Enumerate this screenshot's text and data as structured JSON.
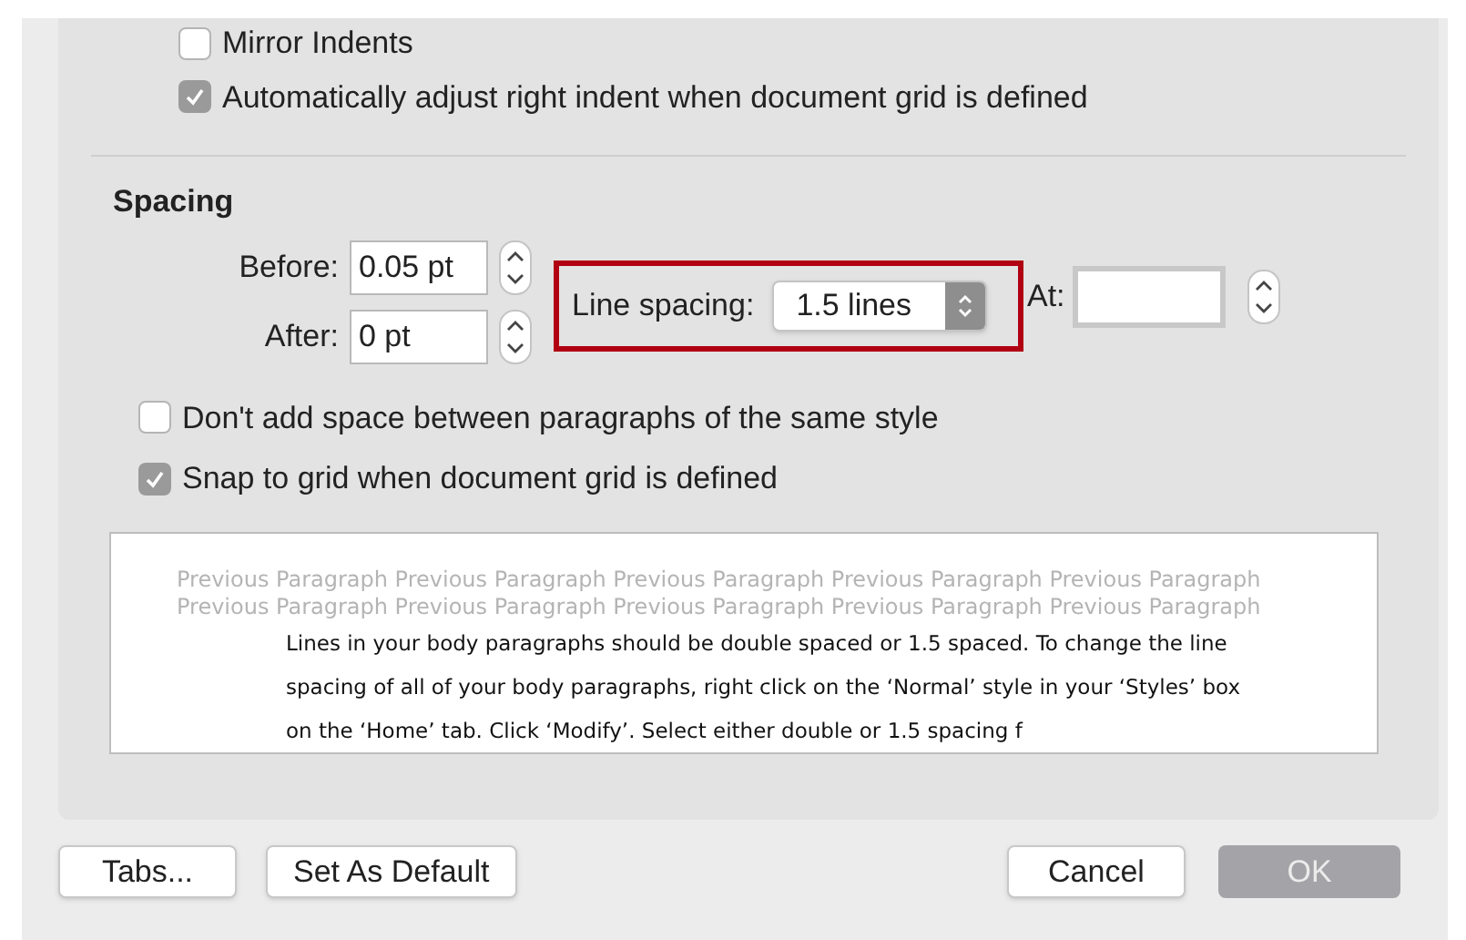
{
  "indents_options": [
    {
      "label": "Mirror Indents",
      "checked": false
    },
    {
      "label": "Automatically adjust right indent when document grid is defined",
      "checked": true
    }
  ],
  "spacing": {
    "heading": "Spacing",
    "before": {
      "label": "Before:",
      "value": "0.05 pt"
    },
    "after": {
      "label": "After:",
      "value": "0 pt"
    },
    "line_spacing": {
      "label": "Line spacing:",
      "value": "1.5 lines"
    },
    "at": {
      "label": "At:"
    },
    "options": [
      {
        "label": "Don't add space between paragraphs of the same style",
        "checked": false
      },
      {
        "label": "Snap to grid when document grid is defined",
        "checked": true
      }
    ]
  },
  "preview": {
    "previous_lines": [
      "Previous Paragraph Previous Paragraph Previous Paragraph Previous Paragraph Previous Paragraph",
      "Previous Paragraph Previous Paragraph Previous Paragraph Previous Paragraph Previous Paragraph"
    ],
    "sample_lines": [
      "Lines in your body paragraphs should be double spaced or 1.5 spaced. To change the line",
      "spacing of all of your body paragraphs, right click on the ‘Normal’ style in your ‘Styles’ box",
      "on the ‘Home’ tab. Click ‘Modify’. Select either double or 1.5 spacing f"
    ]
  },
  "buttons": [
    {
      "label": "Tabs...",
      "disabled": false,
      "kind": "left"
    },
    {
      "label": "Set As Default",
      "disabled": false,
      "kind": "left"
    },
    {
      "label": "Cancel",
      "disabled": false,
      "kind": "right"
    },
    {
      "label": "OK",
      "disabled": true,
      "kind": "right"
    }
  ]
}
